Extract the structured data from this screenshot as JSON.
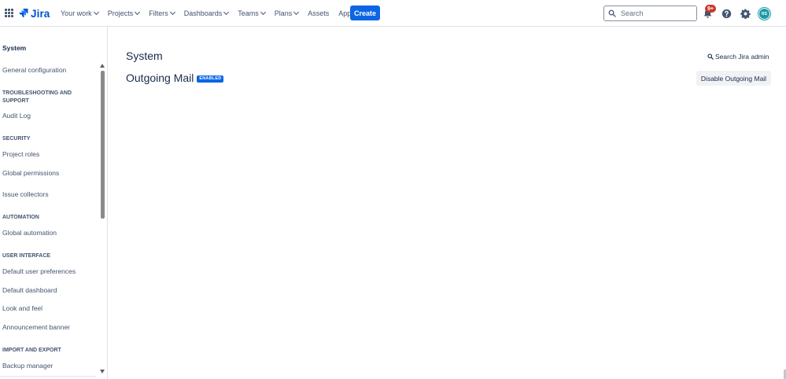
{
  "topnav": {
    "logo_text": "Jira",
    "items": [
      {
        "label": "Your work"
      },
      {
        "label": "Projects"
      },
      {
        "label": "Filters"
      },
      {
        "label": "Dashboards"
      },
      {
        "label": "Teams"
      },
      {
        "label": "Plans"
      },
      {
        "label": "Assets"
      },
      {
        "label": "Apps"
      }
    ],
    "create_label": "Create",
    "search_placeholder": "Search",
    "notification_badge": "9+",
    "avatar_initials": "RS",
    "brand_color": "#0c66e4",
    "avatar_color": "#1d9aaa",
    "badge_color": "#c9372c"
  },
  "sidebar": {
    "title": "System",
    "entries": [
      {
        "type": "item",
        "label": "General configuration"
      },
      {
        "type": "heading",
        "label": "TROUBLESHOOTING AND SUPPORT"
      },
      {
        "type": "item",
        "label": "Audit Log"
      },
      {
        "type": "heading",
        "label": "SECURITY"
      },
      {
        "type": "item",
        "label": "Project roles"
      },
      {
        "type": "item",
        "label": "Global permissions"
      },
      {
        "type": "item",
        "label": "Issue collectors"
      },
      {
        "type": "heading",
        "label": "AUTOMATION"
      },
      {
        "type": "item",
        "label": "Global automation"
      },
      {
        "type": "heading",
        "label": "USER INTERFACE"
      },
      {
        "type": "item",
        "label": "Default user preferences"
      },
      {
        "type": "item",
        "label": "Default dashboard"
      },
      {
        "type": "item",
        "label": "Look and feel"
      },
      {
        "type": "item",
        "label": "Announcement banner"
      },
      {
        "type": "heading",
        "label": "IMPORT AND EXPORT"
      },
      {
        "type": "item",
        "label": "Backup manager"
      }
    ]
  },
  "main": {
    "page_title": "System",
    "section_title": "Outgoing Mail",
    "status_lozenge": "ENABLED",
    "search_admin_label": "Search Jira admin",
    "disable_button_label": "Disable Outgoing Mail"
  }
}
